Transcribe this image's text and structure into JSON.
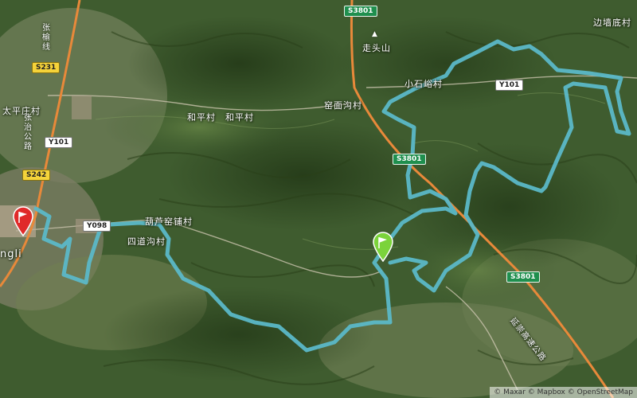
{
  "map": {
    "labels": {
      "zoutoushan": "走头山",
      "bianqiangdicun": "边墙底村",
      "xiaoshixiacun": "小石峪村",
      "yaomiangoucun": "窑面沟村",
      "hepingcun1": "和平村",
      "hepingcun2": "和平村",
      "taipingzhuangcun": "太平庄村",
      "hulupuchuncun": "葫芦窑铺村",
      "sidaogoucun": "四道沟村",
      "town_partial": "ngli",
      "zhangzhilu": "张治公路",
      "zhangyulu": "张榆线",
      "yanchonghighway": "延崇高速公路"
    },
    "shields": {
      "s3801_top": "S3801",
      "s3801_mid": "S3801",
      "s3801_low": "S3801",
      "s231": "S231",
      "s242": "S242",
      "y101_left": "Y101",
      "y101_right": "Y101",
      "y098": "Y098"
    },
    "markers": {
      "start_marker": "start-flag-red",
      "finish_marker": "finish-flag-green",
      "peak_icon": "mountain-peak-icon"
    },
    "colors": {
      "route": "#5bb8c8",
      "highway": "#e8893a",
      "terrain_dark": "#2f4a22",
      "terrain_light": "#5a7a3e"
    },
    "attribution": "© Maxar © Mapbox © OpenStreetMap"
  }
}
